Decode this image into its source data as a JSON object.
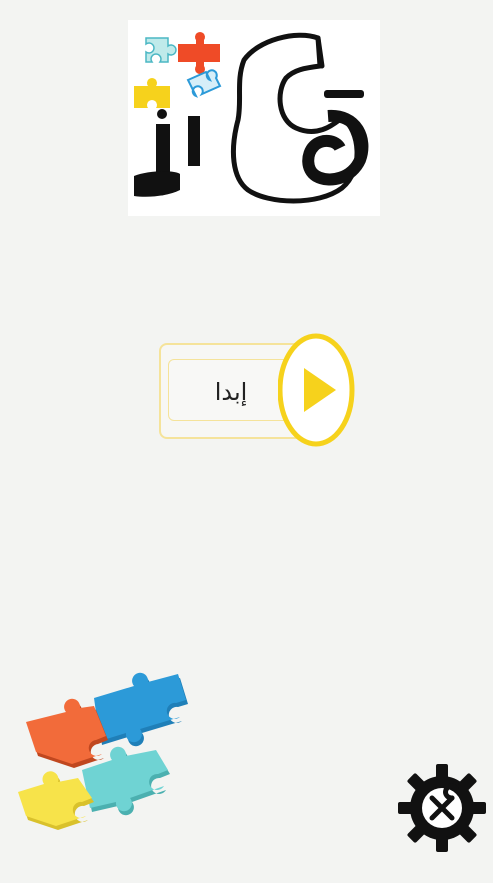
{
  "app": {
    "logo_text": "قادر",
    "logo_icon": "flexed-arm-puzzle-logo"
  },
  "start": {
    "label": "إبدا",
    "icon": "play-icon"
  },
  "settings": {
    "icon": "gear-wrench-icon"
  },
  "decoration": {
    "icon": "puzzle-pieces-icon"
  },
  "colors": {
    "background": "#f3f4f2",
    "accent_yellow": "#f6d21c",
    "puzzle_orange": "#f26b3a",
    "puzzle_blue": "#2c9ad8",
    "puzzle_teal": "#6fd3d3",
    "puzzle_yellow": "#f7e34a"
  }
}
